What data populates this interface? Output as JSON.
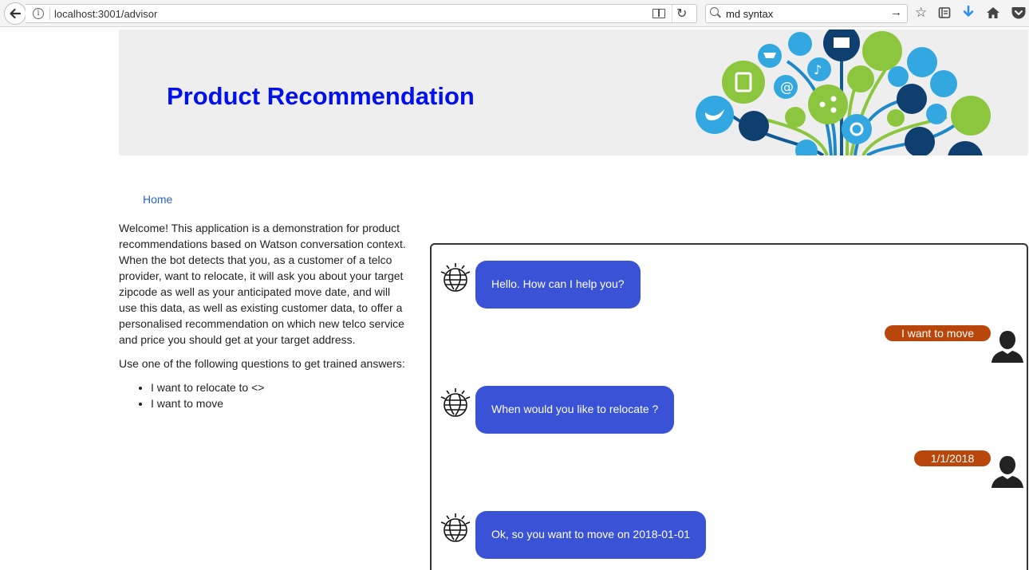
{
  "browser": {
    "url": "localhost:3001/advisor",
    "search_query": "md syntax"
  },
  "header": {
    "title": "Product Recommendation"
  },
  "nav": {
    "home_label": "Home"
  },
  "intro": {
    "paragraph1": "Welcome! This application is a demonstration for product recommendations based on Watson conversation context. When the bot detects that you, as a customer of a telco provider, want to relocate, it will ask you about your target zipcode as well as your anticipated move date, and will use this data, as well as existing customer data, to offer a personalised recommendation on which new telco service and price you should get at your target address.",
    "paragraph2": "Use one of the following questions to get trained answers:",
    "questions": [
      "I want to relocate to <>",
      "I want to move"
    ]
  },
  "chat": {
    "messages": [
      {
        "from": "bot",
        "text": "Hello. How can I help you?"
      },
      {
        "from": "user",
        "text": "I want to move"
      },
      {
        "from": "bot",
        "text": "When would you like to relocate ?"
      },
      {
        "from": "user",
        "text": "1/1/2018"
      },
      {
        "from": "bot",
        "text": "Ok, so you want to move on 2018-01-01"
      }
    ]
  },
  "colors": {
    "title": "#0011ee",
    "bot_bubble": "#3a52d6",
    "user_bubble": "#b9470c",
    "link": "#2a64c5"
  }
}
